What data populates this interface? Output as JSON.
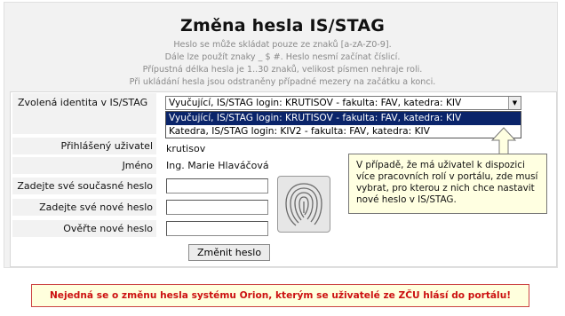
{
  "title": "Změna hesla IS/STAG",
  "hints": [
    "Heslo se může skládat pouze ze znaků [a-zA-Z0-9].",
    "Dále lze použít znaky _ $ #. Heslo nesmí začínat číslicí.",
    "Přípustná délka hesla je 1..30 znaků, velikost písmen nehraje roli.",
    "Při ukládání hesla jsou odstraněny případné mezery na začátku a konci."
  ],
  "form": {
    "identity_label": "Zvolená identita v IS/STAG",
    "identity_selected": "Vyučující, IS/STAG login: KRUTISOV - fakulta: FAV, katedra: KIV",
    "identity_options": [
      "Vyučující, IS/STAG login: KRUTISOV - fakulta: FAV, katedra: KIV",
      "Katedra, IS/STAG login: KIV2 - fakulta: FAV, katedra: KIV"
    ],
    "user_label": "Přihlášený uživatel",
    "user_value": "krutisov",
    "name_label": "Jméno",
    "name_value": "Ing. Marie Hlaváčová",
    "current_pw_label": "Zadejte své současné heslo",
    "new_pw_label": "Zadejte své nové heslo",
    "verify_pw_label": "Ověřte nové heslo",
    "submit_label": "Změnit heslo"
  },
  "tooltip": "V případě, že má uživatel k dispozici více pracovních rolí v portálu, zde musí vybrat, pro kterou z nich chce nastavit nové heslo v IS/STAG.",
  "warning": "Nejedná se o změnu hesla systému Orion, kterým se uživatelé ze ZČU hlásí do portálu!",
  "icons": {
    "fingerprint": "fingerprint-icon",
    "dropdown_arrow": "chevron-down-icon",
    "tooltip_arrow": "arrow-up-icon"
  },
  "colors": {
    "selected_option_bg": "#0a246a",
    "warning_text": "#cc1111",
    "tooltip_bg": "#ffffe1"
  }
}
